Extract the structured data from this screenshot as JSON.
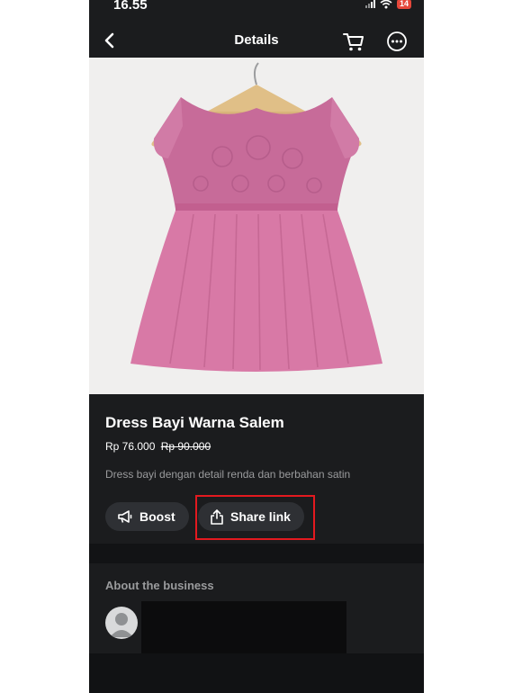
{
  "status_bar": {
    "time": "16.55",
    "battery": "14"
  },
  "header": {
    "title": "Details"
  },
  "product": {
    "title": "Dress Bayi Warna Salem",
    "price": "Rp 76.000",
    "original_price": "Rp 90.000",
    "description": "Dress bayi dengan detail renda dan berbahan satin"
  },
  "actions": {
    "boost_label": "Boost",
    "share_label": "Share link"
  },
  "about": {
    "title": "About the business"
  },
  "colors": {
    "background": "#1b1c1e",
    "button": "#2e3034",
    "highlight": "#e3191f",
    "battery": "#e5473a"
  }
}
